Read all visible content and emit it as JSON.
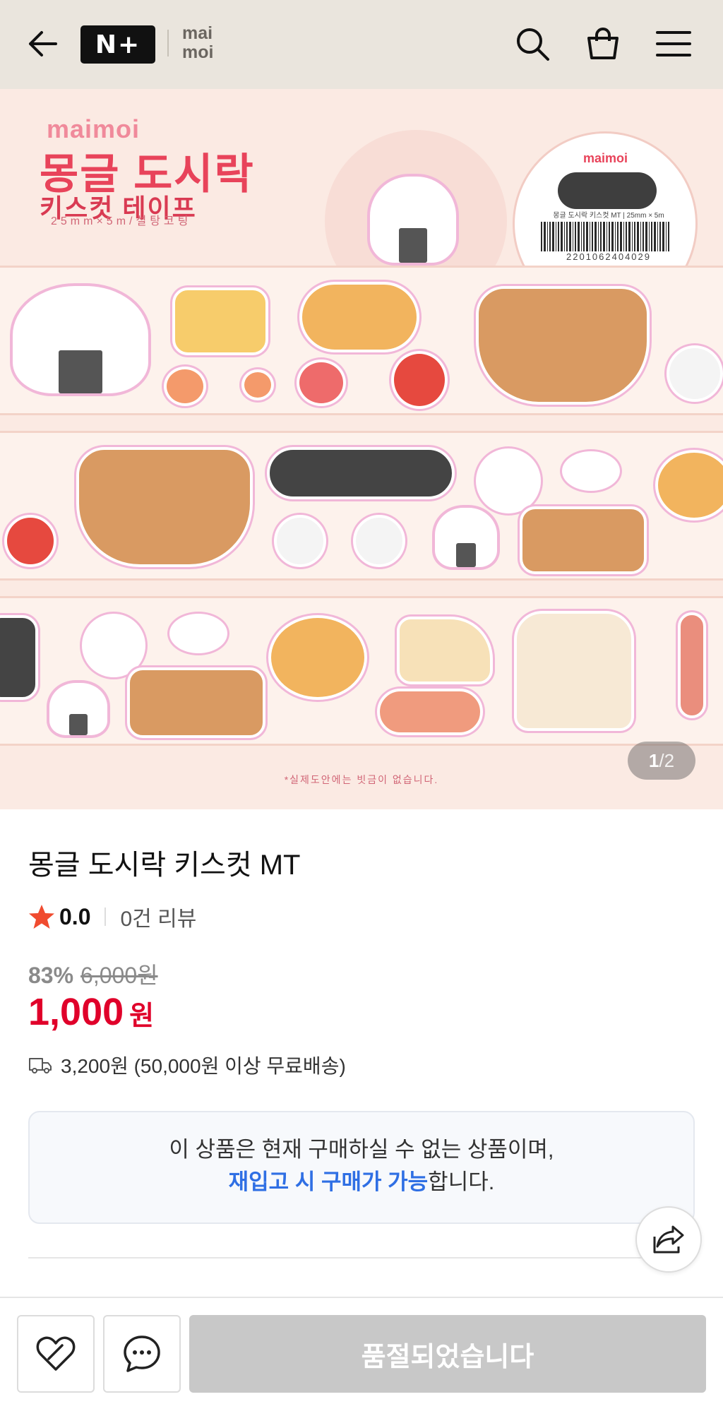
{
  "header": {
    "logo_text": "N+",
    "brand_line1": "mai",
    "brand_line2": "moi"
  },
  "hero": {
    "brand": "maimoi",
    "title_line1": "몽글 도시락",
    "title_line2": "키스컷 테이프",
    "spec": "25mm×5m/설탕코팅",
    "roll_brand": "maimoi",
    "roll_label": "몽글 도시락 키스컷 MT | 25mm × 5m",
    "roll_code": "2201062404029",
    "note": "*실제도안에는 빗금이 없습니다.",
    "counter_current": "1",
    "counter_total": "/2"
  },
  "product": {
    "title": "몽글 도시락 키스컷 MT",
    "rating": "0.0",
    "review_count": "0건 리뷰",
    "discount_percent": "83%",
    "original_price": "6,000원",
    "price": "1,000",
    "price_unit": "원",
    "shipping": "3,200원 (50,000원 이상 무료배송)"
  },
  "notice": {
    "line1": "이 상품은 현재 구매하실 수 없는 상품이며,",
    "line2_highlight": "재입고 시 구매가 가능",
    "line2_rest": "합니다."
  },
  "bottom_bar": {
    "soldout_label": "품절되었습니다"
  },
  "colors": {
    "header_bg": "#eae5dd",
    "price_red": "#e0002a",
    "notice_blue": "#2f6fe4",
    "soldout_gray": "#c8c8c8",
    "star": "#f04b2f"
  }
}
